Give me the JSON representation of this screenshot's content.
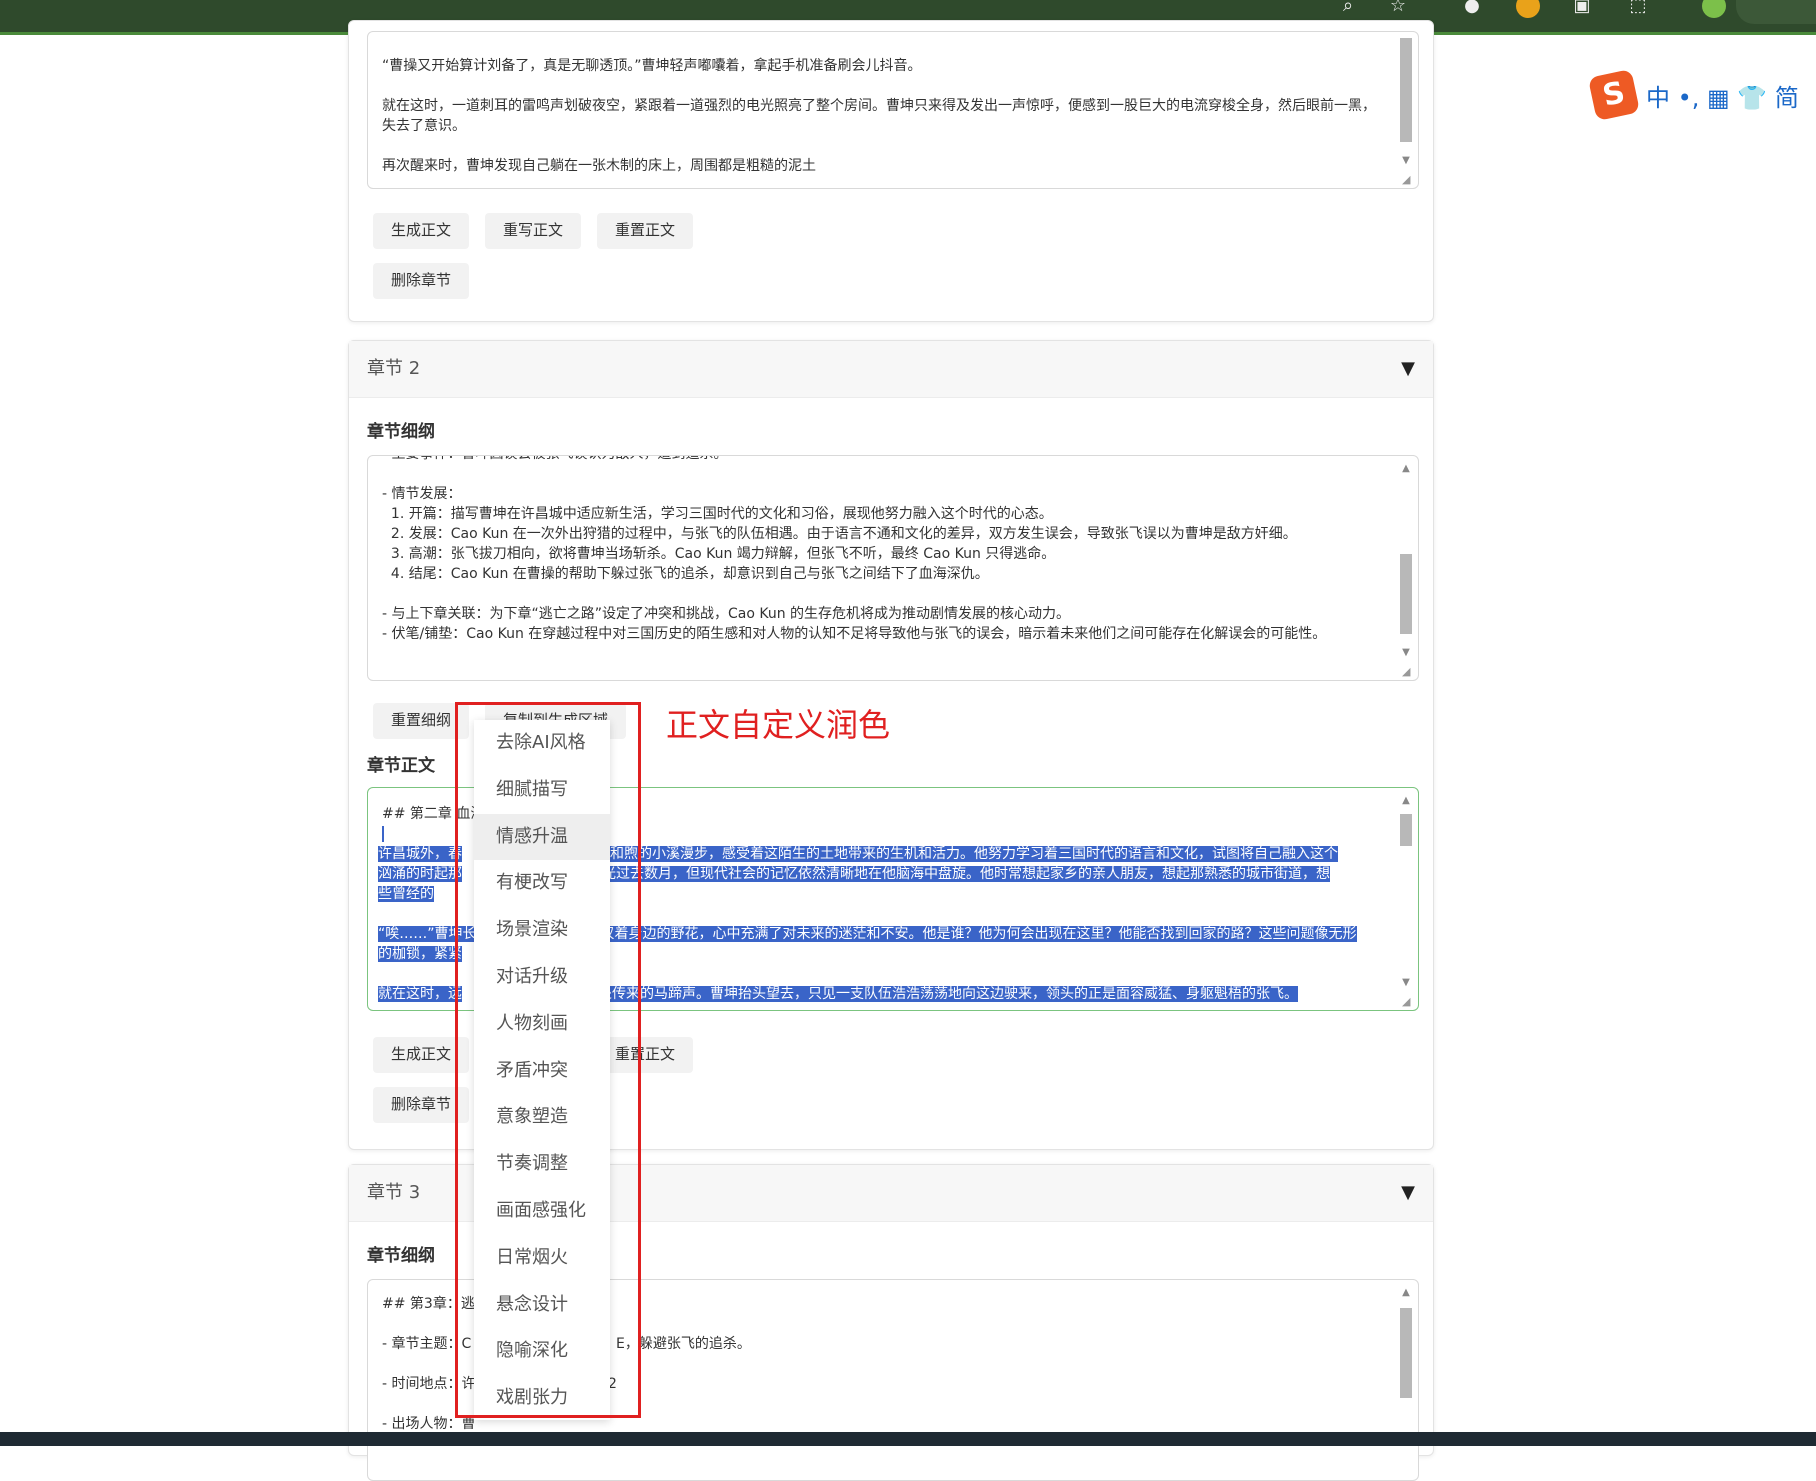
{
  "ime": {
    "logo": "S",
    "label": "中 •, ▦ 👕 简"
  },
  "chapter1": {
    "body_text": "“曹操又开始算计刘备了，真是无聊透顶。”曹坤轻声嘟囔着，拿起手机准备刷会儿抖音。\n\n就在这时，一道刺耳的雷鸣声划破夜空，紧跟着一道强烈的电光照亮了整个房间。曹坤只来得及发出一声惊呼，便感到一股巨大的电流穿梭全身，然后眼前一黑，失去了意识。\n\n再次醒来时，曹坤发现自己躺在一张木制的床上，周围都是粗糙的泥土",
    "buttons": {
      "generate": "生成正文",
      "rewrite": "重写正文",
      "reset": "重置正文",
      "delete": "删除章节"
    }
  },
  "chapter2": {
    "header": "章节 2",
    "outline_label": "章节细纲",
    "outline_text": "- 主要事件：曹坤因误会被张飞误认为敌人，遭到追杀。\n\n- 情节发展：\n  1. 开篇：描写曹坤在许昌城中适应新生活，学习三国时代的文化和习俗，展现他努力融入这个时代的心态。\n  2. 发展：Cao Kun 在一次外出狩猎的过程中，与张飞的队伍相遇。由于语言不通和文化的差异，双方发生误会，导致张飞误以为曹坤是敌方奸细。\n  3. 高潮：张飞拔刀相向，欲将曹坤当场斩杀。Cao Kun 竭力辩解，但张飞不听，最终 Cao Kun 只得逃命。\n  4. 结尾：Cao Kun 在曹操的帮助下躲过张飞的追杀，却意识到自己与张飞之间结下了血海深仇。\n\n- 与上下章关联：为下章“逃亡之路”设定了冲突和挑战，Cao Kun 的生存危机将成为推动剧情发展的核心动力。\n- 伏笔/铺垫：Cao Kun 在穿越过程中对三国历史的陌生感和对人物的认知不足将导致他与张飞的误会，暗示着未来他们之间可能存在化解误会的可能性。",
    "outline_buttons": {
      "reset": "重置细纲",
      "copy": "复制到生成区域"
    },
    "body_label": "章节正文",
    "body_heading": "## 第二章  血海深仇",
    "body_lines": [
      "许昌城外，春",
      "风和煦的小溪漫步，感受着这陌生的土地带来的生机和活力。他努力学习着三国时代的语言和文化，试图将自己融入这个",
      "汹涌的时起那",
      "时光过去数月，但现代社会的记忆依然清晰地在他脑海中盘旋。他时常想起家乡的亲人朋友，想起那熟悉的城市街道，想",
      "些曾经的",
      "“唉……”曹坤长",
      "叹着身边的野花，心中充满了对未来的迷茫和不安。他是谁？他为何会出现在这里？他能否找到回家的路？这些问题像无形",
      "的枷锁，紧紧",
      "就在这时，远",
      "处传来的马蹄声。曹坤抬头望去，只见一支队伍浩浩荡荡地向这边驶来，领头的正是面容威猛、身躯魁梧的张飞。"
    ],
    "buttons": {
      "generate": "生成正文",
      "reset": "重置正文",
      "delete": "删除章节"
    }
  },
  "chapter3": {
    "header": "章节 3",
    "outline_label": "章节细纲",
    "outline_lines": [
      "## 第3章：逃",
      "- 章节主题：C",
      "E，躲避张飞的追杀。",
      "- 时间地点：许",
      "2",
      "- 出场人物：曹"
    ]
  },
  "context_menu": {
    "items": [
      "去除AI风格",
      "细腻描写",
      "情感升温",
      "有梗改写",
      "场景渲染",
      "对话升级",
      "人物刻画",
      "矛盾冲突",
      "意象塑造",
      "节奏调整",
      "画面感强化",
      "日常烟火",
      "悬念设计",
      "隐喻深化",
      "戏剧张力"
    ],
    "hovered": "情感升温"
  },
  "annotation": "正文自定义润色",
  "colors": {
    "selection": "#3a64c8",
    "annotation_red": "#e02020",
    "focus_border": "#7bc47f"
  }
}
